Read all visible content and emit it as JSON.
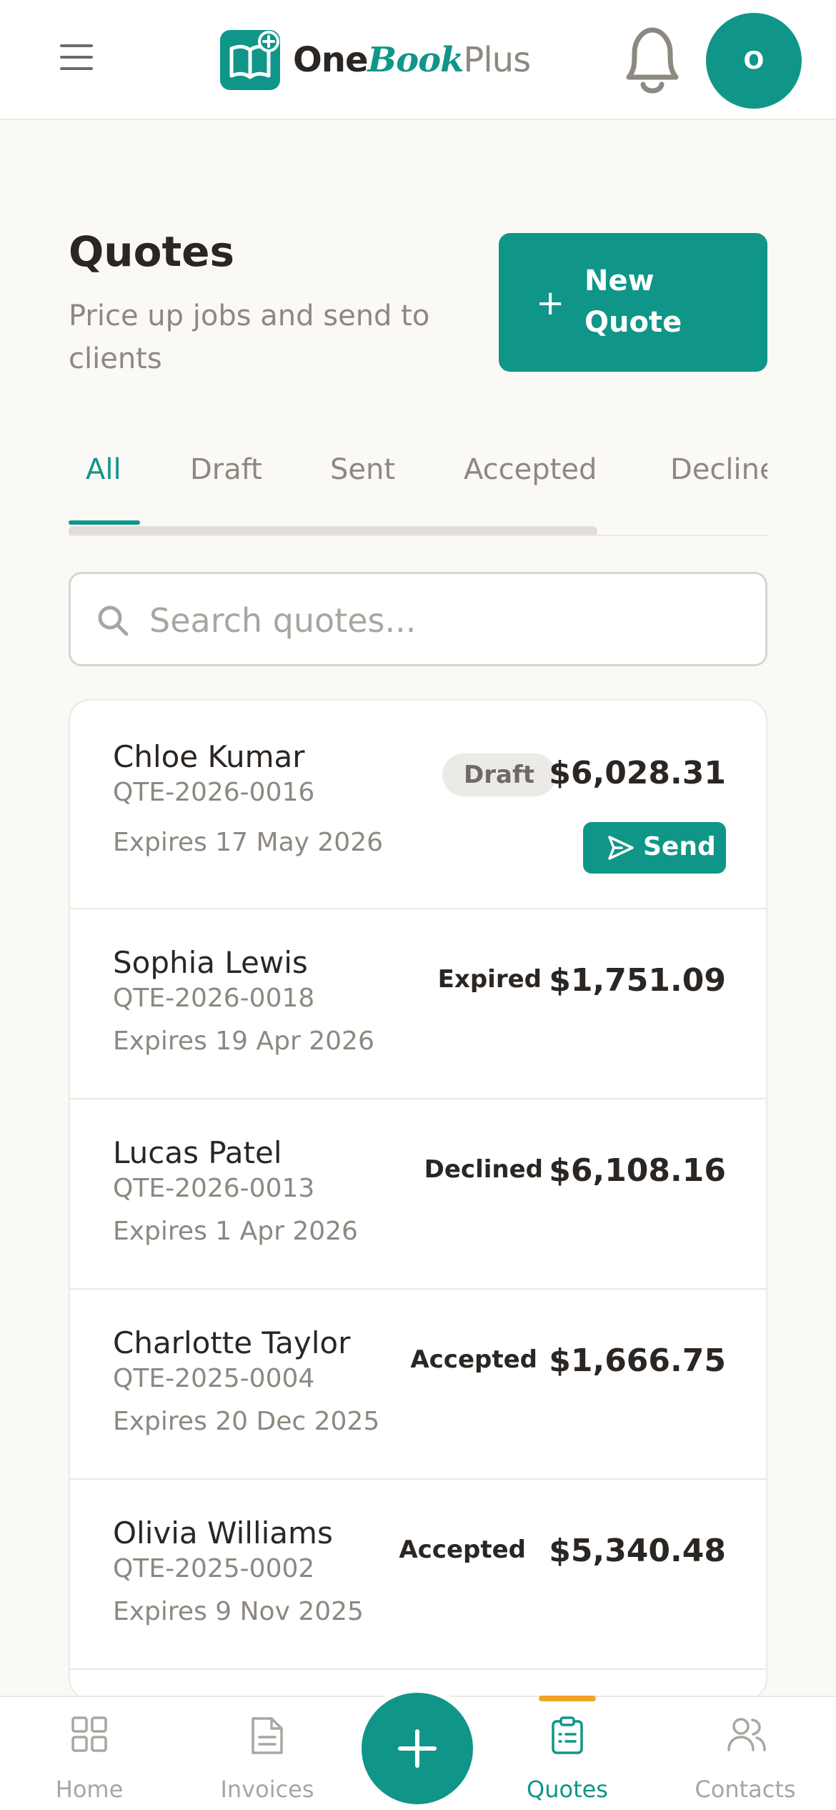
{
  "app": {
    "logo": {
      "one": "One",
      "book": "Book",
      "plus": "Plus"
    },
    "avatar_initial": "O",
    "accent_color": "#0f9688",
    "indicator_color": "#f0a428"
  },
  "header": {
    "title": "Quotes",
    "subtitle": "Price up jobs and send to clients",
    "new_quote_label": "New Quote"
  },
  "tabs": [
    {
      "label": "All",
      "active": true
    },
    {
      "label": "Draft",
      "active": false
    },
    {
      "label": "Sent",
      "active": false
    },
    {
      "label": "Accepted",
      "active": false
    },
    {
      "label": "Declined",
      "active": false
    }
  ],
  "search": {
    "placeholder": "Search quotes...",
    "value": ""
  },
  "quotes": [
    {
      "client": "Chloe Kumar",
      "number": "QTE-2026-0016",
      "expires": "Expires 17 May 2026",
      "status": "Draft",
      "amount": "$6,028.31",
      "action": "Send"
    },
    {
      "client": "Sophia Lewis",
      "number": "QTE-2026-0018",
      "expires": "Expires 19 Apr 2026",
      "status": "Expired",
      "amount": "$1,751.09"
    },
    {
      "client": "Lucas Patel",
      "number": "QTE-2026-0013",
      "expires": "Expires 1 Apr 2026",
      "status": "Declined",
      "amount": "$6,108.16"
    },
    {
      "client": "Charlotte Taylor",
      "number": "QTE-2025-0004",
      "expires": "Expires 20 Dec 2025",
      "status": "Accepted",
      "amount": "$1,666.75"
    },
    {
      "client": "Olivia Williams",
      "number": "QTE-2025-0002",
      "expires": "Expires 9 Nov 2025",
      "status": "Accepted",
      "amount": "$5,340.48"
    }
  ],
  "bottom_nav": [
    {
      "label": "Home",
      "icon": "grid-icon",
      "active": false
    },
    {
      "label": "Invoices",
      "icon": "document-icon",
      "active": false
    },
    {
      "label": "Quotes",
      "icon": "clipboard-icon",
      "active": true
    },
    {
      "label": "Contacts",
      "icon": "users-icon",
      "active": false
    }
  ]
}
